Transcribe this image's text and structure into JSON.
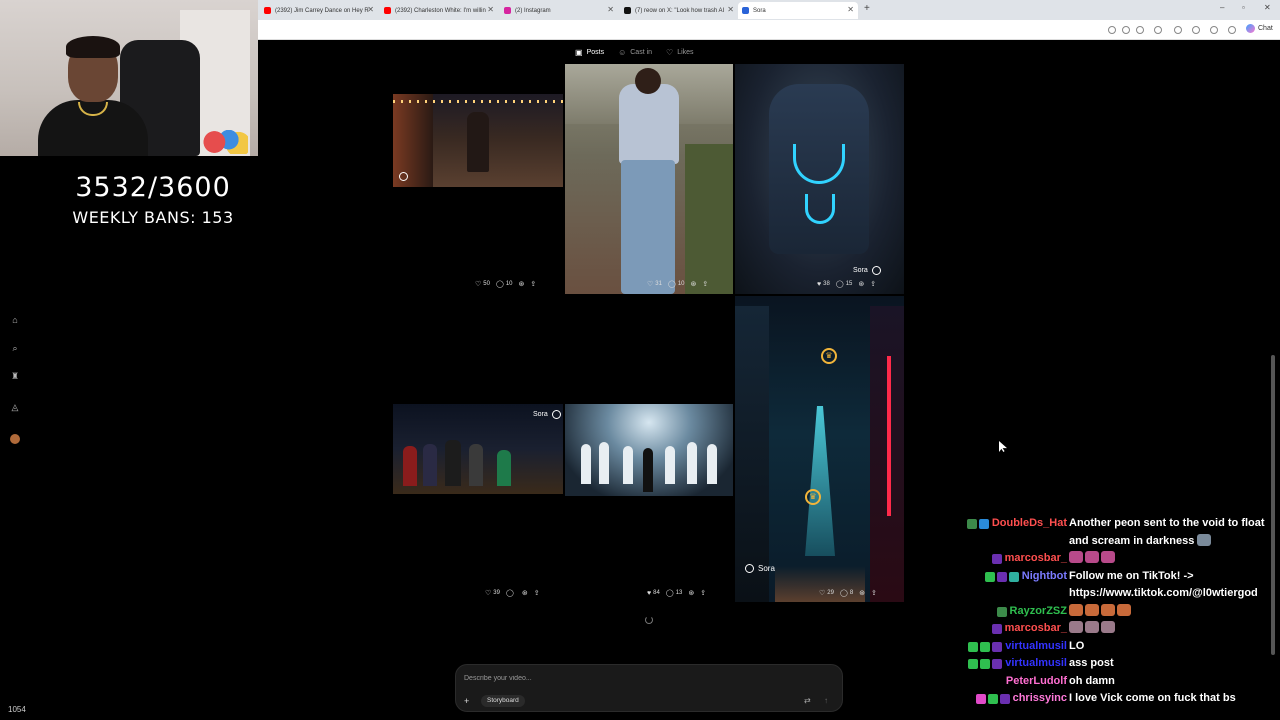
{
  "browser": {
    "tabs": [
      {
        "label": "(2392) Jim Carrey Dance on Hey R",
        "color": "#ff0000"
      },
      {
        "label": "(2392) Charleston White: I'm willin",
        "color": "#ff0000"
      },
      {
        "label": "(2) Instagram",
        "color": "#d6249f"
      },
      {
        "label": "(7) reow on X: \"Look how trash AI",
        "color": "#111111"
      },
      {
        "label": "Sora",
        "color": "#2a63d8"
      }
    ],
    "new_tab": "+",
    "minimize": "–",
    "restore": "▫",
    "close": "✕",
    "copilot_label": "Chat"
  },
  "overlay": {
    "counter": "3532/3600",
    "weekly_bans": "WEEKLY BANS: 153",
    "bottom_count": "1054"
  },
  "profile_tabs": [
    {
      "label": "Posts",
      "icon": "▣",
      "active": true
    },
    {
      "label": "Cast in",
      "icon": "☺",
      "active": false
    },
    {
      "label": "Likes",
      "icon": "♡",
      "active": false
    }
  ],
  "cards": [
    {
      "likes": "50",
      "comments": "10"
    },
    {
      "likes": "31",
      "comments": "10"
    },
    {
      "likes": "38",
      "comments": "15"
    },
    {
      "likes": "39",
      "comments": ""
    },
    {
      "likes": "84",
      "comments": "13"
    },
    {
      "likes": "29",
      "comments": "8"
    }
  ],
  "sora_badge": "Sora",
  "prompt": {
    "placeholder": "Describe your video...",
    "plus": "+",
    "storyboard": "Storyboard",
    "settings_icon": "⇄",
    "send_icon": "↑"
  },
  "chat": [
    {
      "user": "DoubleDs_Hat",
      "color": "#ff4f4f",
      "text": "Another peon sent to the void to float",
      "cont": "and scream in darkness"
    },
    {
      "user": "marcosbar_",
      "color": "#ff4f4f",
      "text": ""
    },
    {
      "user": "Nightbot",
      "color": "#7b7bff",
      "text": "Follow me on TikTok! ->",
      "cont": "https://www.tiktok.com/@l0wtiergod"
    },
    {
      "user": "RayzorZSZ",
      "color": "#2fbf4f",
      "text": ""
    },
    {
      "user": "marcosbar_",
      "color": "#ff4f4f",
      "text": ""
    },
    {
      "user": "virtualmusil",
      "color": "#3333ff",
      "text": "LO"
    },
    {
      "user": "virtualmusil",
      "color": "#3333ff",
      "text": "ass post"
    },
    {
      "user": "PeterLudolf",
      "color": "#ff6fd1",
      "text": "oh damn"
    },
    {
      "user": "chrissyinc",
      "color": "#ff79d9",
      "text": "I love Vick come on fuck that bs"
    }
  ]
}
